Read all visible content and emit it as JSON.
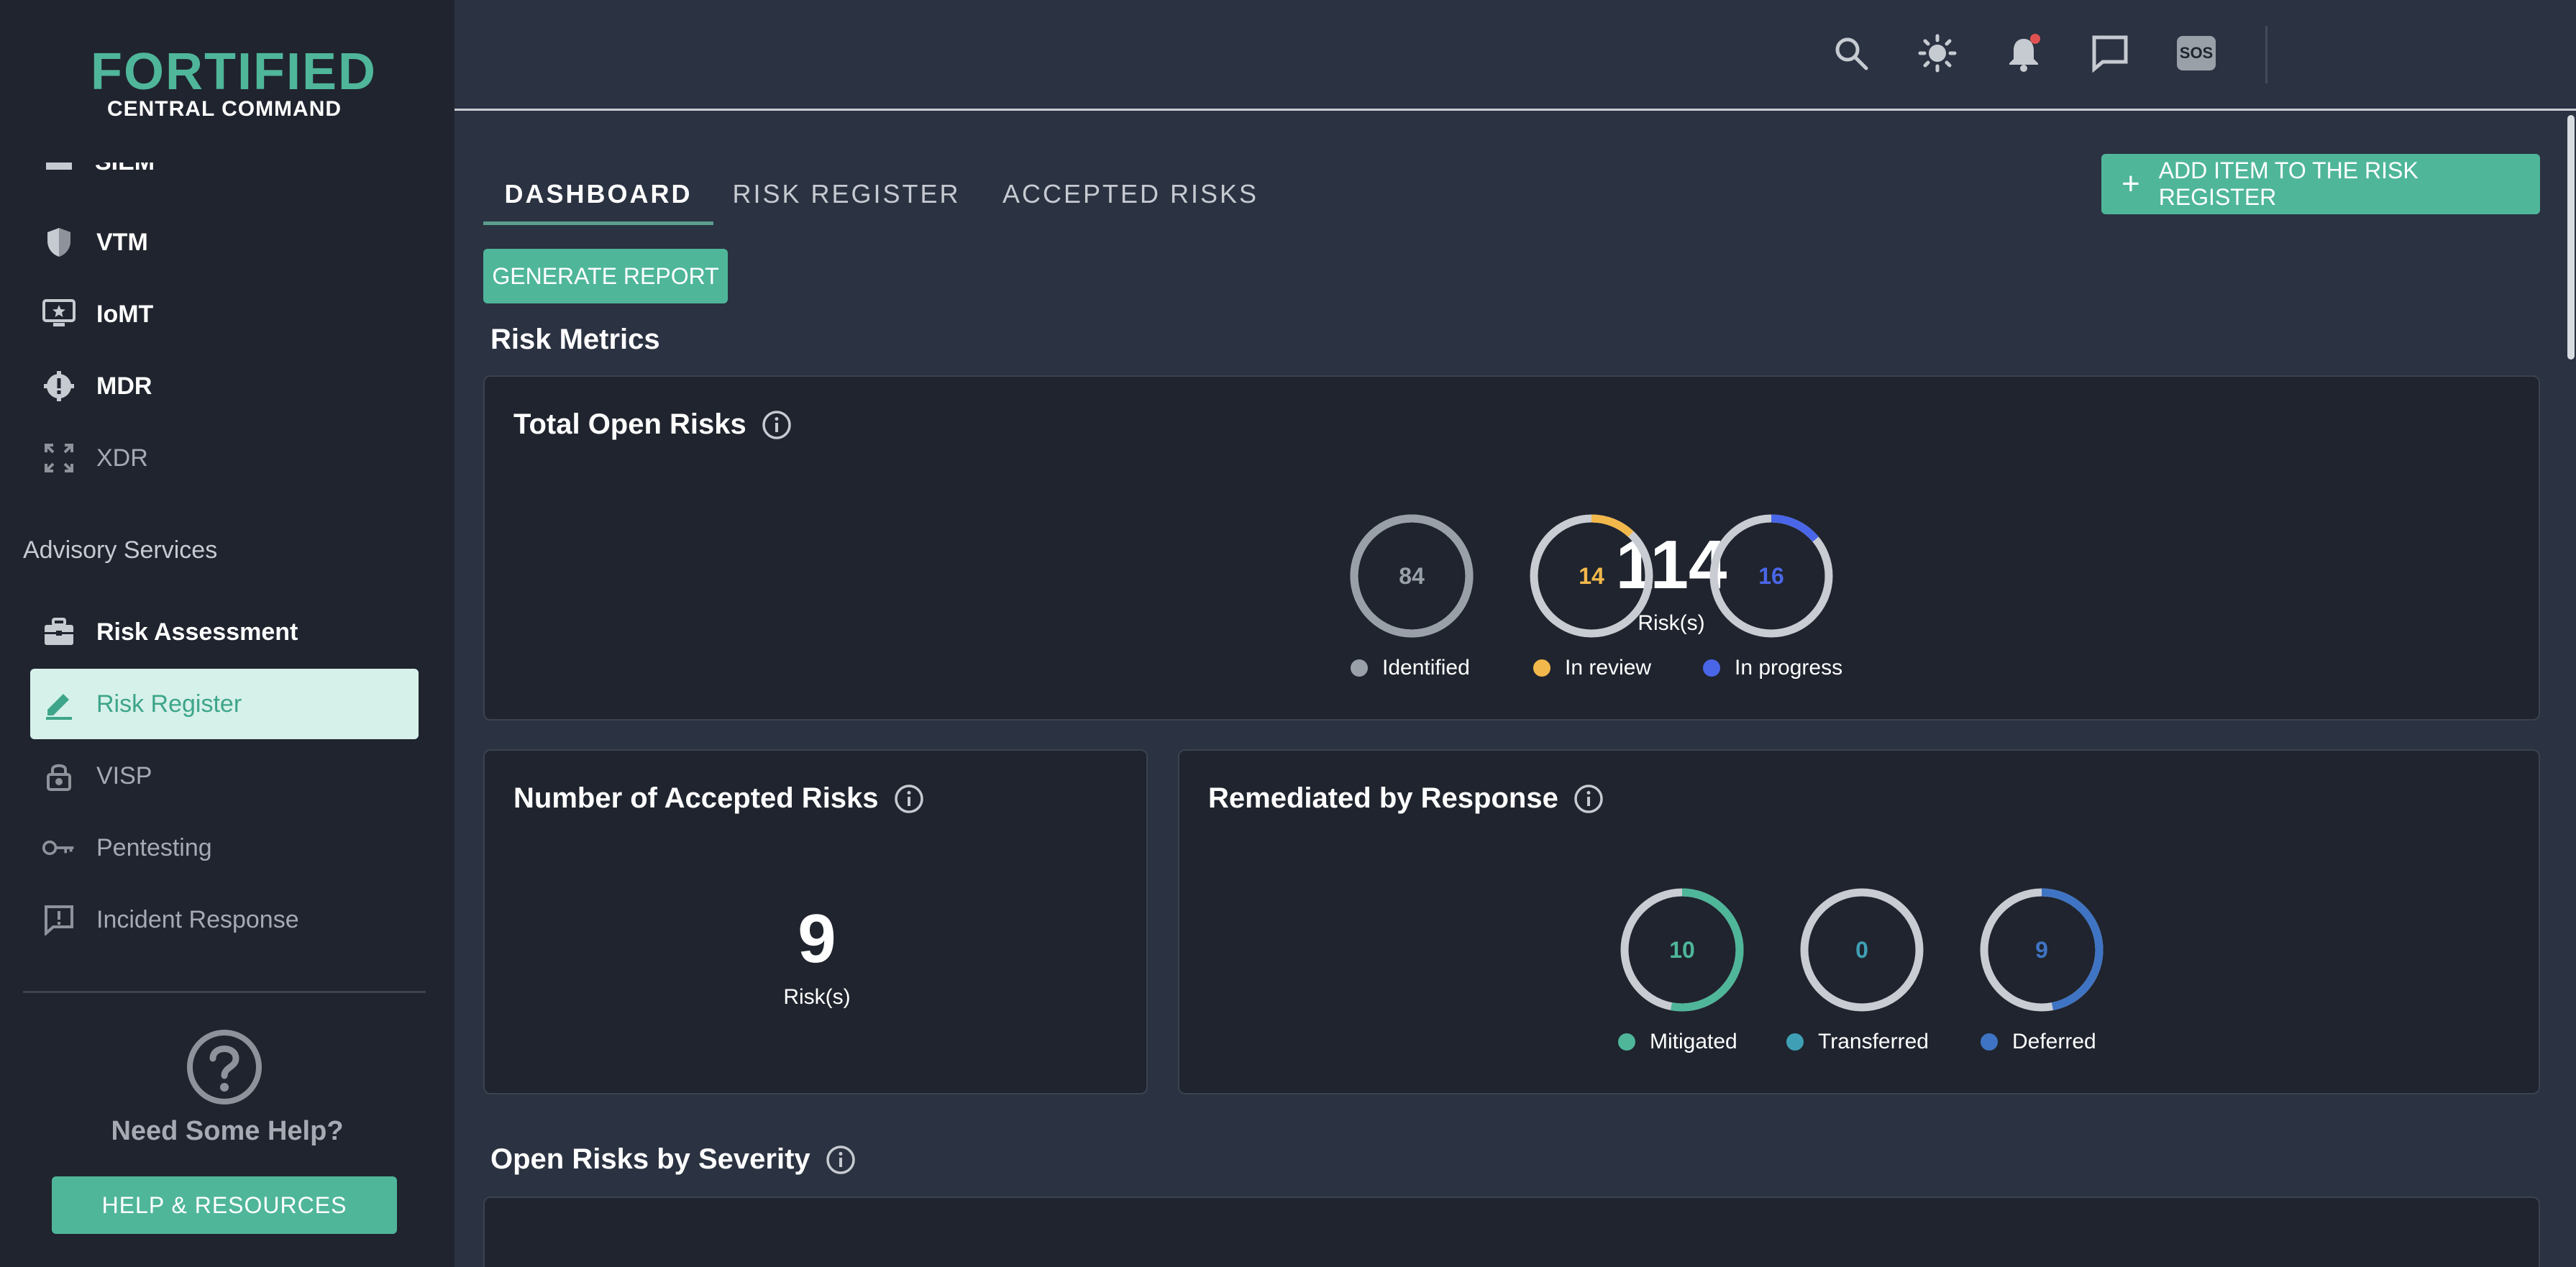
{
  "logo": {
    "top": "FORTIFIED",
    "bottom": "CENTRAL COMMAND"
  },
  "sidebar": {
    "partial_top_label": "SIEM",
    "items": [
      {
        "label": "VTM",
        "icon": "shield-icon",
        "disabled": false
      },
      {
        "label": "IoMT",
        "icon": "monitor-star-icon",
        "disabled": false
      },
      {
        "label": "MDR",
        "icon": "alert-gear-icon",
        "disabled": false
      },
      {
        "label": "XDR",
        "icon": "expand-icon",
        "disabled": true
      }
    ],
    "section_title": "Advisory Services",
    "advisory_items": [
      {
        "label": "Risk Assessment",
        "icon": "briefcase-icon",
        "disabled": false,
        "active": false
      },
      {
        "label": "Risk Register",
        "icon": "pencil-icon",
        "disabled": false,
        "active": true
      },
      {
        "label": "VISP",
        "icon": "lock-icon",
        "disabled": true,
        "active": false
      },
      {
        "label": "Pentesting",
        "icon": "key-icon",
        "disabled": true,
        "active": false
      },
      {
        "label": "Incident Response",
        "icon": "alert-message-icon",
        "disabled": true,
        "active": false
      }
    ],
    "help_text": "Need Some Help?",
    "help_button": "HELP & RESOURCES"
  },
  "topbar": {
    "icons": [
      "search-icon",
      "brightness-icon",
      "bell-icon",
      "chat-icon",
      "sos-icon"
    ],
    "sos_label": "SOS"
  },
  "tabs": [
    {
      "label": "DASHBOARD",
      "active": true
    },
    {
      "label": "RISK REGISTER",
      "active": false
    },
    {
      "label": "ACCEPTED RISKS",
      "active": false
    }
  ],
  "add_button": "ADD ITEM TO THE RISK REGISTER",
  "generate_button": "GENERATE REPORT",
  "risk_metrics_heading": "Risk Metrics",
  "total_open_risks": {
    "title": "Total Open Risks",
    "total": "114",
    "total_label": "Risk(s)",
    "breakdown": [
      {
        "label": "Identified",
        "value": 84,
        "fraction": 1.0,
        "color": "#9aa0a8"
      },
      {
        "label": "In review",
        "value": 14,
        "fraction": 0.12,
        "color": "#f2b84b"
      },
      {
        "label": "In progress",
        "value": 16,
        "fraction": 0.14,
        "color": "#4a66e8"
      }
    ]
  },
  "accepted_risks": {
    "title": "Number of Accepted Risks",
    "total": "9",
    "total_label": "Risk(s)"
  },
  "remediated": {
    "title": "Remediated by Response",
    "breakdown": [
      {
        "label": "Mitigated",
        "value": 10,
        "fraction": 0.53,
        "color": "#4fb69a"
      },
      {
        "label": "Transferred",
        "value": 0,
        "fraction": 0,
        "color": "#3fa0b5"
      },
      {
        "label": "Deferred",
        "value": 9,
        "fraction": 0.47,
        "color": "#3f74c4"
      }
    ]
  },
  "open_by_severity_heading": "Open Risks by Severity"
}
